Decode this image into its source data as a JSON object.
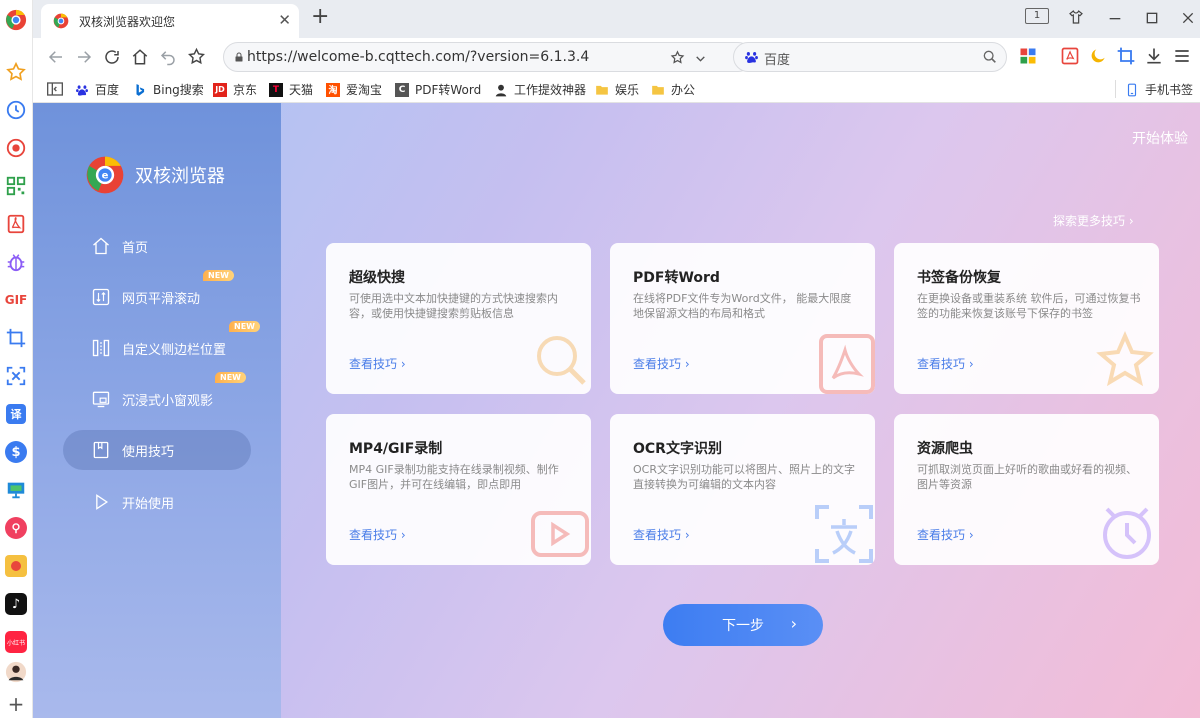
{
  "tab": {
    "title": "双核浏览器欢迎您",
    "close": "✕",
    "new": "+"
  },
  "window": {
    "tab_count": "1"
  },
  "address": {
    "url": "https://welcome-b.cqttech.com/?version=6.1.3.4"
  },
  "search": {
    "engine": "百度"
  },
  "bookmarks": [
    {
      "label": "百度"
    },
    {
      "label": "Bing搜索"
    },
    {
      "label": "京东"
    },
    {
      "label": "天猫"
    },
    {
      "label": "爱淘宝"
    },
    {
      "label": "PDF转Word"
    },
    {
      "label": "工作提效神器"
    },
    {
      "label": "娱乐"
    },
    {
      "label": "办公"
    },
    {
      "label": "手机书签"
    }
  ],
  "bookmark_icons": {
    "jd": "JD",
    "tmall": "T",
    "taobao": "淘",
    "pdf": "C"
  },
  "brand": {
    "name": "双核浏览器"
  },
  "nav": [
    {
      "label": "首页"
    },
    {
      "label": "网页平滑滚动",
      "badge": "NEW"
    },
    {
      "label": "自定义侧边栏位置",
      "badge": "NEW"
    },
    {
      "label": "沉浸式小窗观影",
      "badge": "NEW"
    },
    {
      "label": "使用技巧"
    },
    {
      "label": "开始使用"
    }
  ],
  "header": {
    "start_experience": "开始体验",
    "explore_more": "探索更多技巧 ›"
  },
  "cards": [
    {
      "title": "超级快搜",
      "desc": "可使用选中文本加快捷键的方式快速搜索内容，或使用快捷键搜索剪贴板信息",
      "link": "查看技巧 ›"
    },
    {
      "title": "PDF转Word",
      "desc": "在线将PDF文件专为Word文件， 能最大限度地保留源文档的布局和格式",
      "link": "查看技巧 ›"
    },
    {
      "title": "书签备份恢复",
      "desc": "在更换设备或重装系统 软件后，可通过恢复书签的功能来恢复该账号下保存的书签",
      "link": "查看技巧 ›"
    },
    {
      "title": "MP4/GIF录制",
      "desc": "MP4 GIF录制功能支持在线录制视频、制作GIF图片，并可在线编辑，即点即用",
      "link": "查看技巧 ›"
    },
    {
      "title": "OCR文字识别",
      "desc": "OCR文字识别功能可以将图片、照片上的文字直接转换为可编辑的文本内容",
      "link": "查看技巧 ›"
    },
    {
      "title": "资源爬虫",
      "desc": "可抓取浏览页面上好听的歌曲或好看的视频、图片等资源",
      "link": "查看技巧 ›"
    }
  ],
  "next_button": {
    "label": "下一步",
    "chevron": "›"
  },
  "rail_labels": {
    "gif": "GIF",
    "translate": "译",
    "xhs": "小红书"
  },
  "colors": {
    "accent": "#3d7df2",
    "sidebar": "#6f92db",
    "badge": "#ffb04d"
  }
}
